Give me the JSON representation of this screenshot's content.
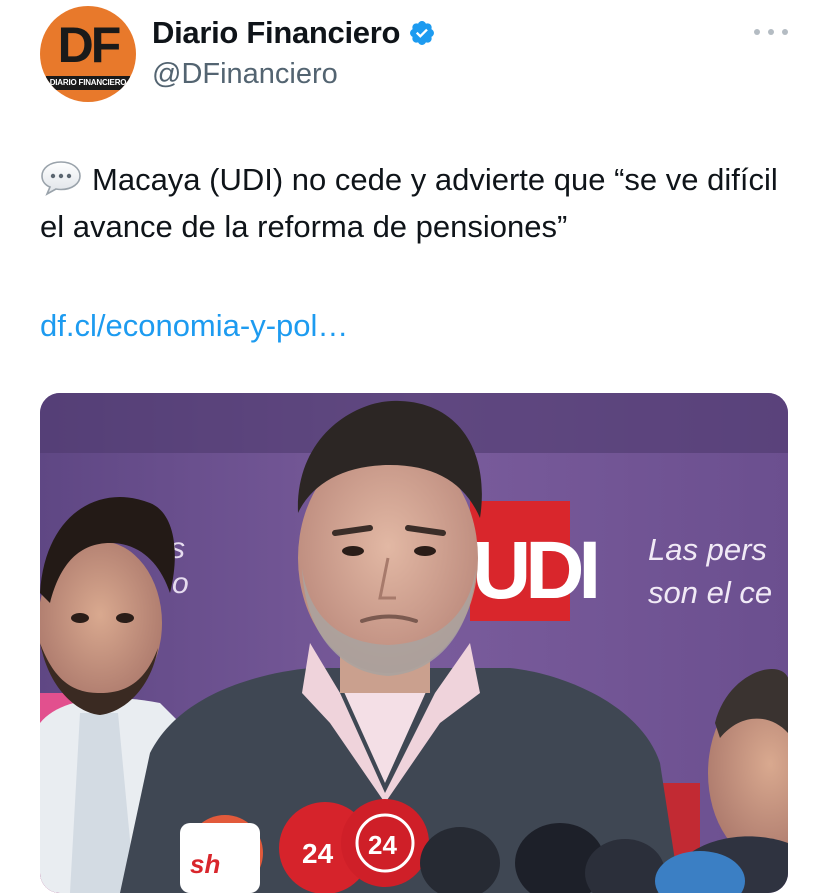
{
  "account": {
    "avatar_letters": "DF",
    "avatar_band_text": "DIARIO FINANCIERO",
    "display_name": "Diario Financiero",
    "handle": "@DFinanciero",
    "verified": true,
    "icons": {
      "verified": "verified-badge-icon",
      "more": "more-options-icon"
    }
  },
  "tweet": {
    "emoji": "speech-balloon-icon",
    "text": "Macaya (UDI) no cede y advierte que “se ve difícil el avance de la reforma de pensiones”",
    "link": "df.cl/economia-y-pol…"
  },
  "media": {
    "backdrop_text_left": "s\no",
    "backdrop_text_right_line1": "Las pers",
    "backdrop_text_right_line2": "son el ce",
    "backdrop_logo": "UDI",
    "mic_label_a": "24",
    "mic_label_b": "24"
  },
  "colors": {
    "link": "#1d9bf0",
    "handle": "#536471",
    "verified": "#1d9bf0",
    "avatar_bg": "#e8792b",
    "backdrop": "#6a4f8c",
    "udi_red": "#d9262c"
  }
}
